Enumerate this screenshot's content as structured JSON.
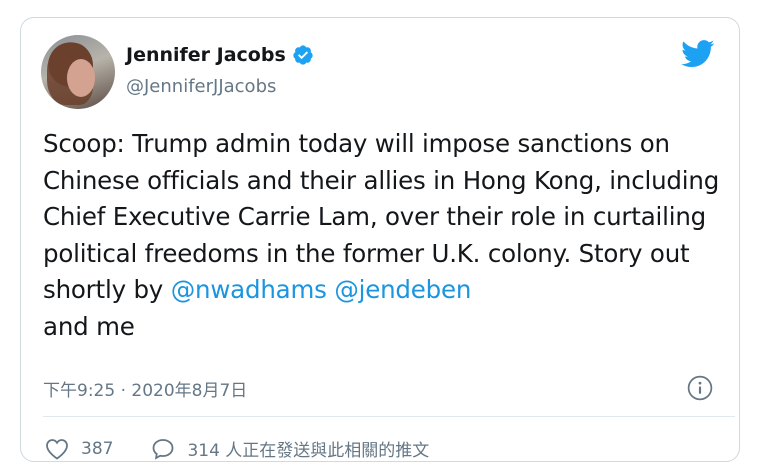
{
  "tweet": {
    "author_name": "Jennifer Jacobs",
    "author_handle": "@JenniferJJacobs",
    "text_before": "Scoop: Trump admin today will impose sanctions on Chinese officials and their allies in Hong Kong, including Chief Executive Carrie Lam, over their role in curtailing political freedoms in the former U.K. colony. Story out shortly by ",
    "mention_1": "@nwadhams",
    "mention_2": "@jendeben",
    "text_after": "and me",
    "timestamp": "下午9:25 · 2020年8月7日",
    "likes": "387",
    "replies_label": "314 人正在發送與此相關的推文"
  },
  "colors": {
    "link": "#1b95e0",
    "secondary_text": "#657786",
    "verified": "#1da1f2"
  },
  "icons": {
    "verified": "verified-badge-icon",
    "brand": "twitter-bird-icon",
    "info": "info-icon",
    "like": "heart-icon",
    "reply": "speech-bubble-icon"
  }
}
